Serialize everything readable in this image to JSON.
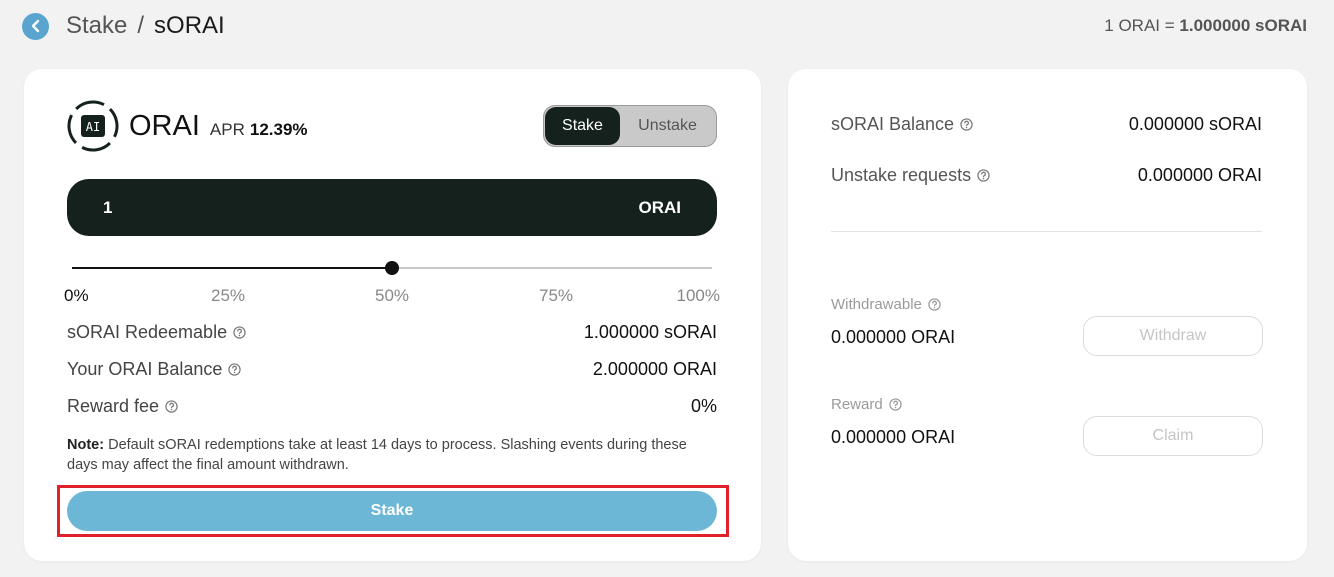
{
  "header": {
    "breadcrumb_parent": "Stake",
    "breadcrumb_separator": "/",
    "breadcrumb_current": "sORAI",
    "rate_prefix": "1 ORAI = ",
    "rate_value": "1.000000 sORAI"
  },
  "stake_panel": {
    "token_logo_text": "AI",
    "token_name": "ORAI",
    "apr_label": "APR",
    "apr_value": "12.39%",
    "toggle": {
      "stake": "Stake",
      "unstake": "Unstake",
      "active": "stake"
    },
    "amount": {
      "value": "1",
      "unit": "ORAI"
    },
    "slider": {
      "percent": 50,
      "ticks": [
        "0%",
        "25%",
        "50%",
        "75%",
        "100%"
      ]
    },
    "rows": [
      {
        "label": "sORAI Redeemable",
        "value": "1.000000 sORAI"
      },
      {
        "label": "Your ORAI Balance",
        "value": "2.000000 ORAI"
      },
      {
        "label": "Reward fee",
        "value": "0%"
      }
    ],
    "note_label": "Note:",
    "note_text": " Default sORAI redemptions take at least 14 days to process. Slashing events during these days may affect the final amount withdrawn.",
    "stake_button": "Stake"
  },
  "info_panel": {
    "balance_label": "sORAI Balance",
    "balance_value": "0.000000 sORAI",
    "unstake_label": "Unstake requests",
    "unstake_value": "0.000000 ORAI",
    "withdrawable_label": "Withdrawable",
    "withdrawable_value": "0.000000 ORAI",
    "withdraw_button": "Withdraw",
    "reward_label": "Reward",
    "reward_value": "0.000000 ORAI",
    "claim_button": "Claim"
  },
  "colors": {
    "accent": "#6db7d6",
    "dark": "#15211d",
    "highlight": "#e0212b"
  },
  "icons": {
    "back": "chevron-left-icon",
    "help": "question-circle-icon",
    "token": "orai-logo-icon"
  }
}
